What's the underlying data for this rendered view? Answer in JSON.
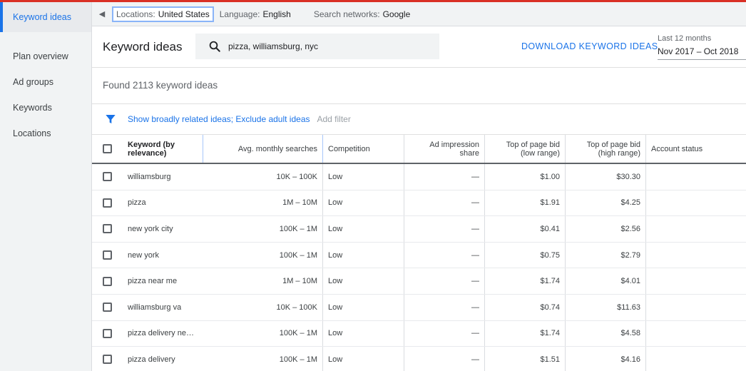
{
  "sidebar": {
    "items": [
      {
        "label": "Keyword ideas"
      },
      {
        "label": "Plan overview"
      },
      {
        "label": "Ad groups"
      },
      {
        "label": "Keywords"
      },
      {
        "label": "Locations"
      }
    ]
  },
  "filters": {
    "location_label": "Locations:",
    "location_value": "United States",
    "language_label": "Language:",
    "language_value": "English",
    "network_label": "Search networks:",
    "network_value": "Google"
  },
  "header": {
    "title": "Keyword ideas",
    "search_value": "pizza, williamsburg, nyc",
    "download_label": "DOWNLOAD KEYWORD IDEAS",
    "date_label": "Last 12 months",
    "date_value": "Nov 2017 – Oct 2018"
  },
  "found_text": "Found 2113 keyword ideas",
  "filter_row": {
    "link_text": "Show broadly related ideas; Exclude adult ideas",
    "add_filter": "Add filter"
  },
  "table": {
    "headers": {
      "keyword": "Keyword (by relevance)",
      "avg": "Avg. monthly searches",
      "competition": "Competition",
      "impression": "Ad impression share",
      "low_bid": "Top of page bid (low range)",
      "high_bid": "Top of page bid (high range)",
      "account": "Account status"
    },
    "rows": [
      {
        "keyword": "williamsburg",
        "avg": "10K – 100K",
        "competition": "Low",
        "impression": "—",
        "low_bid": "$1.00",
        "high_bid": "$30.30",
        "account": ""
      },
      {
        "keyword": "pizza",
        "avg": "1M – 10M",
        "competition": "Low",
        "impression": "—",
        "low_bid": "$1.91",
        "high_bid": "$4.25",
        "account": ""
      },
      {
        "keyword": "new york city",
        "avg": "100K – 1M",
        "competition": "Low",
        "impression": "—",
        "low_bid": "$0.41",
        "high_bid": "$2.56",
        "account": ""
      },
      {
        "keyword": "new york",
        "avg": "100K – 1M",
        "competition": "Low",
        "impression": "—",
        "low_bid": "$0.75",
        "high_bid": "$2.79",
        "account": ""
      },
      {
        "keyword": "pizza near me",
        "avg": "1M – 10M",
        "competition": "Low",
        "impression": "—",
        "low_bid": "$1.74",
        "high_bid": "$4.01",
        "account": ""
      },
      {
        "keyword": "williamsburg va",
        "avg": "10K – 100K",
        "competition": "Low",
        "impression": "—",
        "low_bid": "$0.74",
        "high_bid": "$11.63",
        "account": ""
      },
      {
        "keyword": "pizza delivery near ...",
        "avg": "100K – 1M",
        "competition": "Low",
        "impression": "—",
        "low_bid": "$1.74",
        "high_bid": "$4.58",
        "account": ""
      },
      {
        "keyword": "pizza delivery",
        "avg": "100K – 1M",
        "competition": "Low",
        "impression": "—",
        "low_bid": "$1.51",
        "high_bid": "$4.16",
        "account": ""
      }
    ]
  },
  "colors": {
    "accent": "#1a73e8",
    "top_bar": "#d93025"
  },
  "icons": {
    "search": "search-icon",
    "filter": "funnel-icon",
    "collapse": "chevron-left-icon"
  }
}
